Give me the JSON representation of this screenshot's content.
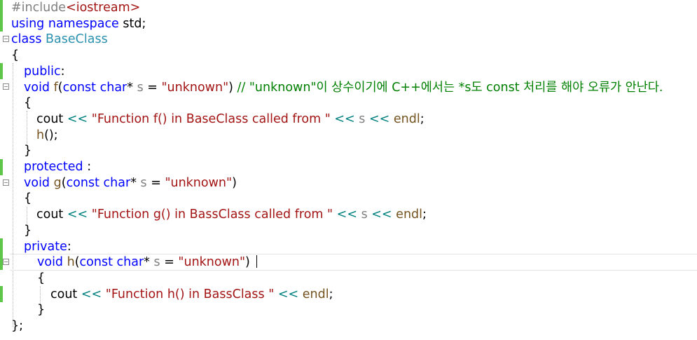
{
  "editor": {
    "lines": [
      {
        "tokens": [
          {
            "t": "#include",
            "c": "pp"
          },
          {
            "t": "<iostream>",
            "c": "inc"
          }
        ]
      },
      {
        "tokens": [
          {
            "t": "using",
            "c": "kw"
          },
          {
            "t": " ",
            "c": "plain"
          },
          {
            "t": "namespace",
            "c": "kw"
          },
          {
            "t": " std;",
            "c": "plain"
          }
        ]
      },
      {
        "tokens": [
          {
            "t": "class",
            "c": "kw"
          },
          {
            "t": " ",
            "c": "plain"
          },
          {
            "t": "BaseClass",
            "c": "cls"
          }
        ]
      },
      {
        "tokens": [
          {
            "t": "{",
            "c": "plain"
          }
        ]
      },
      {
        "tokens": [
          {
            "t": "public",
            "c": "kw"
          },
          {
            "t": ":",
            "c": "plain"
          }
        ]
      },
      {
        "tokens": [
          {
            "t": "void",
            "c": "kw"
          },
          {
            "t": " ",
            "c": "plain"
          },
          {
            "t": "f",
            "c": "fn"
          },
          {
            "t": "(",
            "c": "plain"
          },
          {
            "t": "const",
            "c": "kw"
          },
          {
            "t": " ",
            "c": "plain"
          },
          {
            "t": "char",
            "c": "kw"
          },
          {
            "t": "* ",
            "c": "plain"
          },
          {
            "t": "s",
            "c": "param"
          },
          {
            "t": " = ",
            "c": "plain"
          },
          {
            "t": "\"unknown\"",
            "c": "str"
          },
          {
            "t": ") ",
            "c": "plain"
          },
          {
            "t": "// \"unknown\"이 상수이기에 C++에서는 *s도 const 처리를 해야 오류가 안난다.",
            "c": "cmt"
          }
        ]
      },
      {
        "tokens": [
          {
            "t": "{",
            "c": "plain"
          }
        ]
      },
      {
        "tokens": [
          {
            "t": "cout ",
            "c": "plain"
          },
          {
            "t": "<<",
            "c": "op"
          },
          {
            "t": " ",
            "c": "plain"
          },
          {
            "t": "\"Function f() in BaseClass called from \"",
            "c": "str"
          },
          {
            "t": " ",
            "c": "plain"
          },
          {
            "t": "<<",
            "c": "op"
          },
          {
            "t": " ",
            "c": "plain"
          },
          {
            "t": "s",
            "c": "param"
          },
          {
            "t": " ",
            "c": "plain"
          },
          {
            "t": "<<",
            "c": "op"
          },
          {
            "t": " ",
            "c": "plain"
          },
          {
            "t": "endl",
            "c": "fn"
          },
          {
            "t": ";",
            "c": "plain"
          }
        ]
      },
      {
        "tokens": [
          {
            "t": "h",
            "c": "fn"
          },
          {
            "t": "();",
            "c": "plain"
          }
        ]
      },
      {
        "tokens": [
          {
            "t": "}",
            "c": "plain"
          }
        ]
      },
      {
        "tokens": [
          {
            "t": "protected",
            "c": "kw"
          },
          {
            "t": " :",
            "c": "plain"
          }
        ]
      },
      {
        "tokens": [
          {
            "t": "void",
            "c": "kw"
          },
          {
            "t": " ",
            "c": "plain"
          },
          {
            "t": "g",
            "c": "fn"
          },
          {
            "t": "(",
            "c": "plain"
          },
          {
            "t": "const",
            "c": "kw"
          },
          {
            "t": " ",
            "c": "plain"
          },
          {
            "t": "char",
            "c": "kw"
          },
          {
            "t": "* ",
            "c": "plain"
          },
          {
            "t": "s",
            "c": "param"
          },
          {
            "t": " = ",
            "c": "plain"
          },
          {
            "t": "\"unknown\"",
            "c": "str"
          },
          {
            "t": ")",
            "c": "plain"
          }
        ]
      },
      {
        "tokens": [
          {
            "t": "{",
            "c": "plain"
          }
        ]
      },
      {
        "tokens": [
          {
            "t": "cout ",
            "c": "plain"
          },
          {
            "t": "<<",
            "c": "op"
          },
          {
            "t": " ",
            "c": "plain"
          },
          {
            "t": "\"Function g() in BassClass called from \"",
            "c": "str"
          },
          {
            "t": " ",
            "c": "plain"
          },
          {
            "t": "<<",
            "c": "op"
          },
          {
            "t": " ",
            "c": "plain"
          },
          {
            "t": "s",
            "c": "param"
          },
          {
            "t": " ",
            "c": "plain"
          },
          {
            "t": "<<",
            "c": "op"
          },
          {
            "t": " ",
            "c": "plain"
          },
          {
            "t": "endl",
            "c": "fn"
          },
          {
            "t": ";",
            "c": "plain"
          }
        ]
      },
      {
        "tokens": [
          {
            "t": "}",
            "c": "plain"
          }
        ]
      },
      {
        "tokens": [
          {
            "t": "private",
            "c": "kw"
          },
          {
            "t": ":",
            "c": "plain"
          }
        ]
      },
      {
        "tokens": [
          {
            "t": "void",
            "c": "kw"
          },
          {
            "t": " ",
            "c": "plain"
          },
          {
            "t": "h",
            "c": "fn"
          },
          {
            "t": "(",
            "c": "plain"
          },
          {
            "t": "const",
            "c": "kw"
          },
          {
            "t": " ",
            "c": "plain"
          },
          {
            "t": "char",
            "c": "kw"
          },
          {
            "t": "* ",
            "c": "plain"
          },
          {
            "t": "s",
            "c": "param"
          },
          {
            "t": " = ",
            "c": "plain"
          },
          {
            "t": "\"unknown\"",
            "c": "str"
          },
          {
            "t": ")",
            "c": "plain"
          }
        ]
      },
      {
        "tokens": [
          {
            "t": "{",
            "c": "plain"
          }
        ]
      },
      {
        "tokens": [
          {
            "t": "cout ",
            "c": "plain"
          },
          {
            "t": "<<",
            "c": "op"
          },
          {
            "t": " ",
            "c": "plain"
          },
          {
            "t": "\"Function h() in BassClass \"",
            "c": "str"
          },
          {
            "t": " ",
            "c": "plain"
          },
          {
            "t": "<<",
            "c": "op"
          },
          {
            "t": " ",
            "c": "plain"
          },
          {
            "t": "endl",
            "c": "fn"
          },
          {
            "t": ";",
            "c": "plain"
          }
        ]
      },
      {
        "tokens": [
          {
            "t": "}",
            "c": "plain"
          }
        ]
      },
      {
        "tokens": [
          {
            "t": "};",
            "c": "plain"
          }
        ]
      }
    ]
  }
}
